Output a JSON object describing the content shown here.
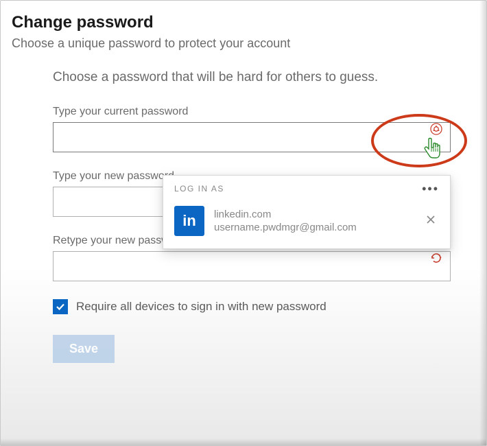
{
  "header": {
    "title": "Change password",
    "subtitle": "Choose a unique password to protect your account",
    "helper": "Choose a password that will be hard for others to guess."
  },
  "fields": {
    "current": {
      "label": "Type your current password",
      "value": ""
    },
    "new": {
      "label": "Type your new password",
      "value": ""
    },
    "retype": {
      "label": "Retype your new password",
      "value": ""
    }
  },
  "checkbox": {
    "label": "Require all devices to sign in with new password",
    "checked": true
  },
  "actions": {
    "save": "Save"
  },
  "password_manager": {
    "title": "LOG IN AS",
    "logo_text": "in",
    "site": "linkedin.com",
    "username": "username.pwdmgr@gmail.com"
  }
}
